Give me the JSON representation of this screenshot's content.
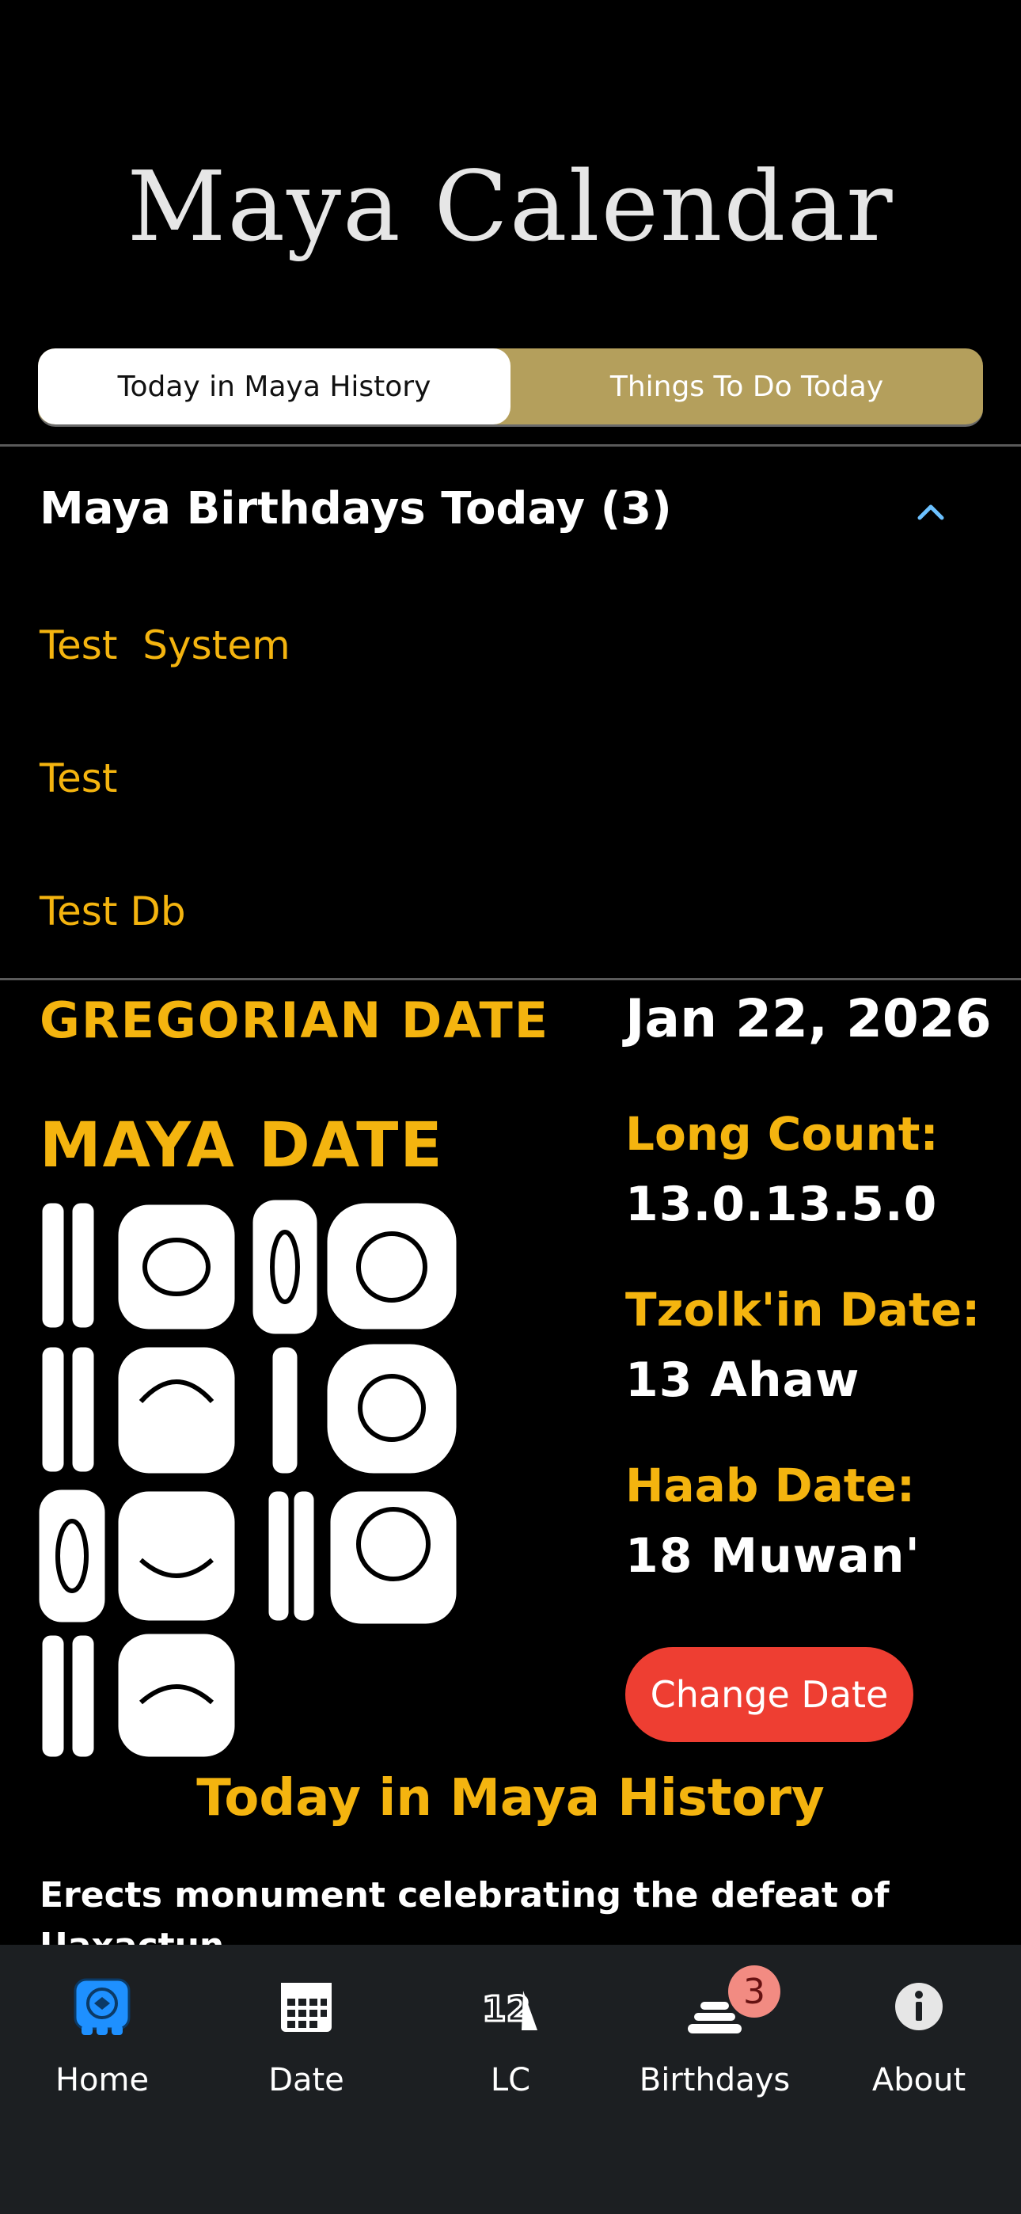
{
  "header": {
    "title": "Maya Calendar"
  },
  "segment": {
    "tabs": [
      "Today in Maya History",
      "Things To Do Today"
    ],
    "active_index": 0
  },
  "birthdays": {
    "header": "Maya Birthdays Today (3)",
    "items": [
      "Test  System",
      "Test",
      "Test Db"
    ]
  },
  "gregorian": {
    "label": "GREGORIAN DATE",
    "value": "Jan 22, 2026"
  },
  "maya": {
    "label": "MAYA DATE",
    "long_count_label": "Long Count:",
    "long_count_value": "13.0.13.5.0",
    "tzolkin_label": "Tzolk'in Date:",
    "tzolkin_value": "13 Ahaw",
    "haab_label": "Haab Date:",
    "haab_value": "18 Muwan'",
    "change_button": "Change Date"
  },
  "history": {
    "title": "Today in Maya History",
    "text": "Erects monument celebrating the defeat of Uaxactun"
  },
  "tabbar": {
    "items": [
      {
        "label": "Home",
        "icon": "maya-glyph-icon",
        "active": true
      },
      {
        "label": "Date",
        "icon": "calendar-icon"
      },
      {
        "label": "LC",
        "icon": "long-count-icon"
      },
      {
        "label": "Birthdays",
        "icon": "cake-icon",
        "badge": "3"
      },
      {
        "label": "About",
        "icon": "info-icon"
      }
    ]
  },
  "colors": {
    "accent": "#f4b40f",
    "segment_inactive": "#b49f5c",
    "button": "#ee3e32",
    "tabbar_bg": "#1c1f22",
    "active_icon": "#1e90ff"
  }
}
